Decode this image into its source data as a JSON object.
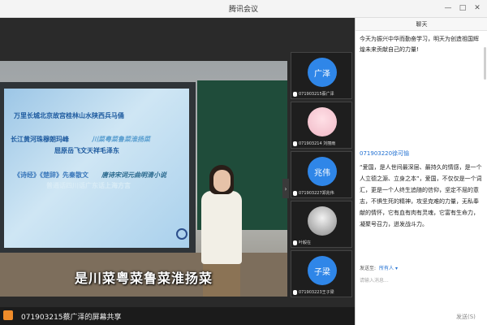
{
  "window": {
    "title": "腾讯会议",
    "controls": [
      "—",
      "□",
      "✕"
    ]
  },
  "stage": {
    "board_lines": [
      "万里长城北京故宫桂林山水陕西兵马俑",
      "长江黄河珠穆朗玛峰",
      "川菜粤菜鲁菜淮扬菜",
      "屈原岳飞文天祥毛泽东",
      "《诗经》《楚辞》先秦散文",
      "唐诗宋词元曲明清小说",
      "普通话四川话广东话上海方言",
      ""
    ],
    "subtitle": "是川菜粤菜鲁菜淮扬菜",
    "toggle_icon": "›"
  },
  "participants": [
    {
      "avatar_text": "广泽",
      "avatar_color": "#2f86e8",
      "name": "071903215蔡广泽"
    },
    {
      "avatar_text": "",
      "avatar_color": "",
      "name": "071903214 刘丽雨"
    },
    {
      "avatar_text": "兆伟",
      "avatar_color": "#2f86e8",
      "name": "071903227郑兆伟"
    },
    {
      "avatar_text": "",
      "avatar_color": "",
      "name": "叶毅在"
    },
    {
      "avatar_text": "子梁",
      "avatar_color": "#2f86e8",
      "name": "071903223王子梁"
    }
  ],
  "statusbar": {
    "share_text": "071903215蔡广泽的屏幕共享"
  },
  "chat": {
    "title": "聊天",
    "message1": "今天为振兴中华而勤奋学习，明天为创造祖国辉煌未来贡献自己的力量!",
    "sender": "071903220徐可愉",
    "message2": "“爱国，是人世间最深层、最持久的情感，是一个人立德之源、立身之本”，爱国，不仅仅是一个词汇，更是一个人终生追随的信仰，坚定不屈的意志，不惧生死的精神，攻坚克难的力量，无私奉献的情怀，它有血有肉有灵魂，它富有生命力，凝聚号召力，迸发战斗力。",
    "send_to_label": "发送至:",
    "send_to_value": "所有人 ▾",
    "input_placeholder": "请输入消息...",
    "send_button": "发送(S)"
  }
}
